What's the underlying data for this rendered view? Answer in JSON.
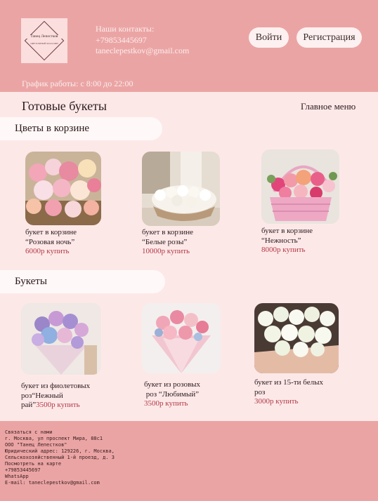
{
  "header": {
    "logo": {
      "name": "Танец Лепестков",
      "subtitle": "ЦВЕТОЧНЫЙ МАГАЗИН"
    },
    "contacts": {
      "label": "Наши контакты:",
      "phone": "+79853445697",
      "email": "taneclepestkov@gmail.com"
    },
    "login_label": "Войти",
    "register_label": "Регистрация",
    "schedule": "График работы: с 8:00 до 22:00"
  },
  "page": {
    "title": "Готовые букеты",
    "main_menu": "Главное меню"
  },
  "sections": [
    {
      "title": "Цветы в корзине",
      "products": [
        {
          "title": "букет в корзине\n“Розовая ночь”",
          "price": "6000р",
          "buy": "купить"
        },
        {
          "title": "букет в корзине\n“Белые розы”",
          "price": "10000р",
          "buy": "купить"
        },
        {
          "title": "букет в корзине\n“Нежность”",
          "price": "8000р",
          "buy": "купить"
        }
      ]
    },
    {
      "title": "Букеты",
      "products": [
        {
          "title": "букет из фиолетовых\nроз“Нежный\nрай”",
          "price": "3500р",
          "buy": "купить"
        },
        {
          "title": "букет из розовых\n роз “Любимый”",
          "price": "3500р",
          "buy": "купить"
        },
        {
          "title": "букет из 15-ти белых\nроз",
          "price": "3000р",
          "buy": "купить"
        }
      ]
    }
  ],
  "footer": {
    "lines": [
      "Связаться с нами",
      "г. Москва, ул проспект Мира, 88с1",
      "ООО \"Танец Лепестков\"",
      "Юридический адрес: 129226, г. Москва,",
      "Сельскохозяйственный 1-й проезд, д. 3",
      "Посмотреть на карте",
      "+79853445697",
      "WhatsApp",
      "E-mail: taneclepestkov@gmail.com"
    ]
  },
  "colors": {
    "header_bg": "#eba4a4",
    "page_bg": "#fde8e8",
    "pill_bg": "#fff8f8",
    "price": "#b13a46"
  }
}
